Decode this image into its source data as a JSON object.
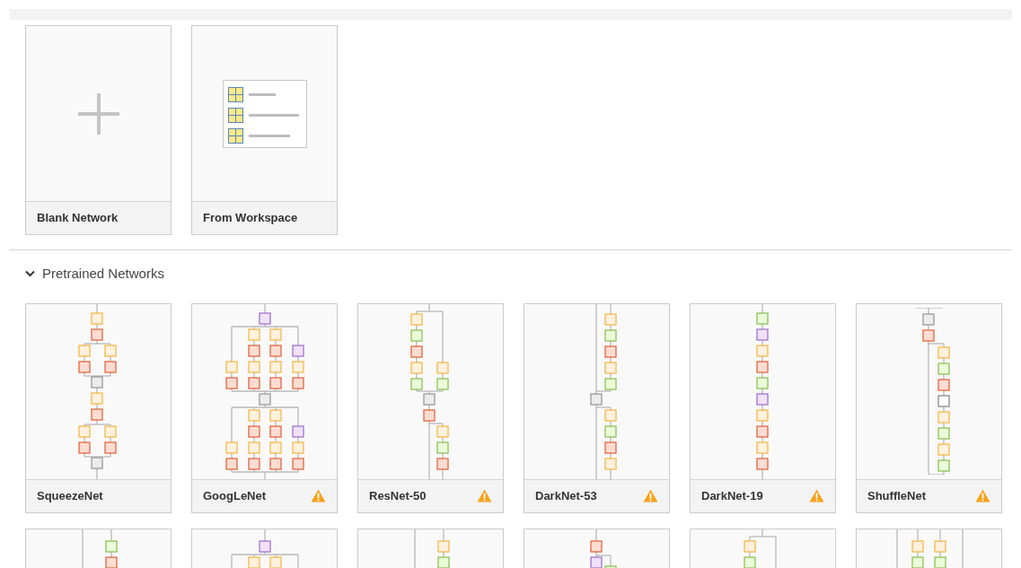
{
  "start_cards": [
    {
      "label": "Blank Network",
      "kind": "blank"
    },
    {
      "label": "From Workspace",
      "kind": "workspace"
    }
  ],
  "pretrained": {
    "title": "Pretrained Networks",
    "expanded": true,
    "networks": [
      {
        "kind": "full",
        "name": "SqueezeNet",
        "warning": false
      },
      {
        "kind": "full",
        "name": "GoogLeNet",
        "warning": true
      },
      {
        "kind": "full",
        "name": "ResNet-50",
        "warning": true
      },
      {
        "kind": "full",
        "name": "DarkNet-53",
        "warning": true
      },
      {
        "kind": "full",
        "name": "DarkNet-19",
        "warning": true
      },
      {
        "kind": "full",
        "name": "ShuffleNet",
        "warning": true
      },
      {
        "kind": "cut_off"
      },
      {
        "kind": "cut_off"
      },
      {
        "kind": "cut_off"
      },
      {
        "kind": "cut_off"
      },
      {
        "kind": "cut_off"
      },
      {
        "kind": "cut_off"
      }
    ]
  }
}
